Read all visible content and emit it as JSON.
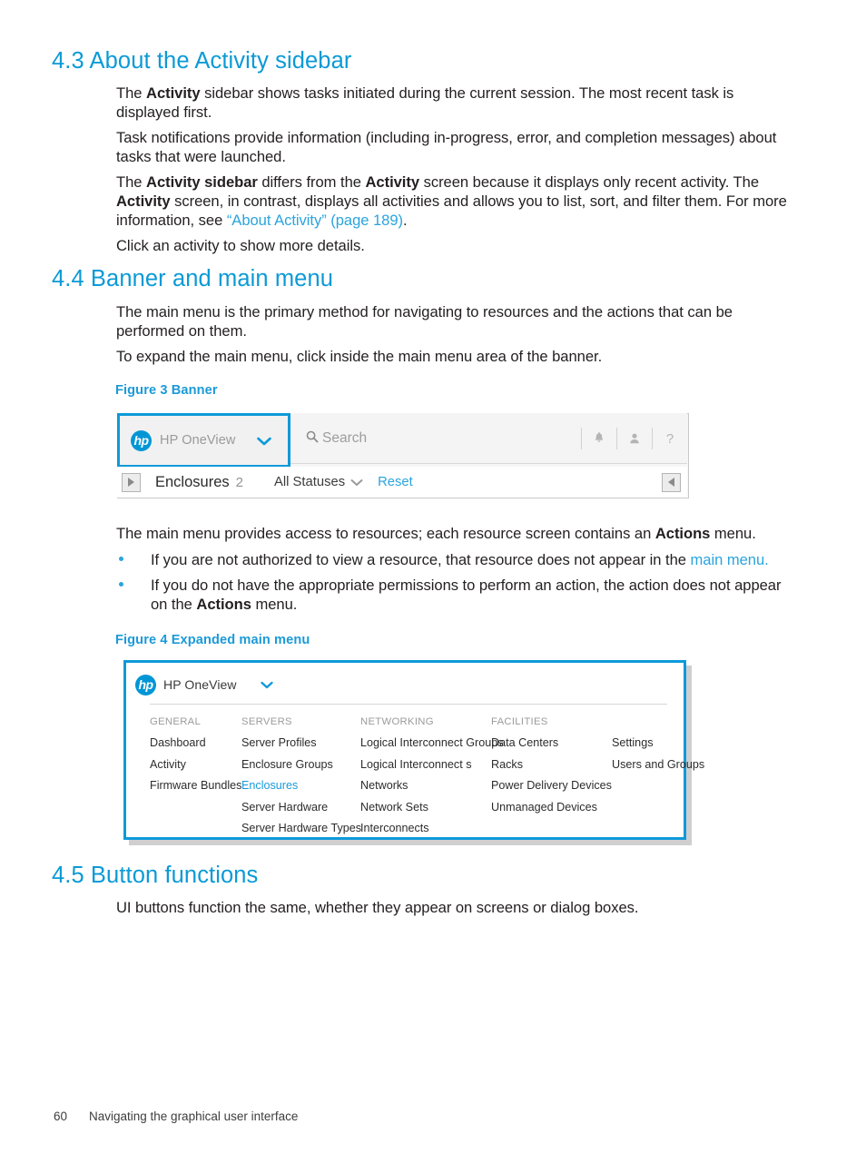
{
  "sections": [
    {
      "id": "activity-sidebar",
      "heading": "4.3 About the Activity sidebar",
      "paragraphs": [
        {
          "id": "p1",
          "runs": [
            {
              "t": "The ",
              "s": "n"
            },
            {
              "t": "Activity",
              "s": "b"
            },
            {
              "t": " sidebar shows tasks initiated during the current session. The most recent task is displayed first.",
              "s": "n"
            }
          ]
        },
        {
          "id": "p2",
          "runs": [
            {
              "t": "Task notifications provide information (including in-progress, error, and completion messages) about tasks that were launched.",
              "s": "n"
            }
          ]
        },
        {
          "id": "p3",
          "runs": [
            {
              "t": "The ",
              "s": "n"
            },
            {
              "t": "Activity sidebar",
              "s": "b"
            },
            {
              "t": " differs from the ",
              "s": "n"
            },
            {
              "t": "Activity",
              "s": "b"
            },
            {
              "t": " screen because it displays only recent activity. The ",
              "s": "n"
            },
            {
              "t": "Activity",
              "s": "b"
            },
            {
              "t": " screen, in contrast, displays all activities and allows you to list, sort, and filter them. For more information, see ",
              "s": "n"
            },
            {
              "t": "“About Activity” (page 189)",
              "s": "link"
            },
            {
              "t": ".",
              "s": "n"
            }
          ]
        },
        {
          "id": "p4",
          "runs": [
            {
              "t": "Click an activity to show more details.",
              "s": "n"
            }
          ]
        }
      ]
    },
    {
      "id": "banner-main-menu",
      "heading": "4.4 Banner and main menu",
      "paragraphs": [
        {
          "id": "p1",
          "runs": [
            {
              "t": "The main menu is the primary method for navigating to resources and the actions that can be performed on them.",
              "s": "n"
            }
          ]
        },
        {
          "id": "p2",
          "runs": [
            {
              "t": "To expand the main menu, click inside the main menu area of the banner.",
              "s": "n"
            }
          ]
        }
      ],
      "after_paragraphs": [
        {
          "id": "p3",
          "runs": [
            {
              "t": "The main menu provides access to resources; each resource screen contains an ",
              "s": "n"
            },
            {
              "t": "Actions",
              "s": "b"
            },
            {
              "t": " menu.",
              "s": "n"
            }
          ]
        }
      ],
      "bullets": [
        {
          "id": "b1",
          "runs": [
            {
              "t": "If you are not authorized to view a resource, that resource does not appear in the ",
              "s": "n"
            },
            {
              "t": "main menu.",
              "s": "link"
            }
          ]
        },
        {
          "id": "b2",
          "runs": [
            {
              "t": "If you do not have the appropriate permissions to perform an action, the action does not appear on the ",
              "s": "n"
            },
            {
              "t": "Actions",
              "s": "b"
            },
            {
              "t": " menu.",
              "s": "n"
            }
          ]
        }
      ]
    },
    {
      "id": "button-functions",
      "heading": "4.5 Button functions",
      "paragraphs": [
        {
          "id": "p1",
          "runs": [
            {
              "t": "UI buttons function the same, whether they appear on screens or dialog boxes.",
              "s": "n"
            }
          ]
        }
      ]
    }
  ],
  "figure3": {
    "caption": "Figure 3 Banner",
    "banner": {
      "main_menu": {
        "logo_text": "hp",
        "product_title": "HP OneView",
        "chevron": "⌄"
      },
      "search": {
        "icon": "search-icon",
        "placeholder": "Search"
      },
      "icons": [
        {
          "name": "notification-bell-icon",
          "glyph": "🔔"
        },
        {
          "name": "user-account-icon",
          "glyph": "👤"
        },
        {
          "name": "help-icon",
          "glyph": "?"
        }
      ],
      "resource_bar": {
        "expand_button": "expand-sidebar-button",
        "resource_name": "Enclosures",
        "resource_count": "2",
        "filter_label": "All Statuses",
        "filter_chevron": "⌄",
        "reset_label": "Reset",
        "collapse_button": "collapse-panel-button"
      }
    }
  },
  "figure4": {
    "caption": "Figure 4 Expanded main menu",
    "menu": {
      "logo_text": "hp",
      "product_title": "HP OneView",
      "chevron": "⌄",
      "columns": [
        {
          "header": "GENERAL",
          "items": [
            {
              "label": "Dashboard",
              "active": false
            },
            {
              "label": "Activity",
              "active": false
            },
            {
              "label": "Firmware Bundles",
              "active": false
            }
          ]
        },
        {
          "header": "SERVERS",
          "items": [
            {
              "label": "Server Profiles",
              "active": false
            },
            {
              "label": "Enclosure Groups",
              "active": false
            },
            {
              "label": "Enclosures",
              "active": true
            },
            {
              "label": "Server Hardware",
              "active": false
            },
            {
              "label": "Server Hardware Types",
              "active": false
            }
          ]
        },
        {
          "header": "NETWORKING",
          "items": [
            {
              "label": "Logical Interconnect Groups",
              "active": false
            },
            {
              "label": "Logical Interconnect s",
              "active": false
            },
            {
              "label": "Networks",
              "active": false
            },
            {
              "label": "Network Sets",
              "active": false
            },
            {
              "label": "Interconnects",
              "active": false
            }
          ]
        },
        {
          "header": "FACILITIES",
          "items": [
            {
              "label": "Data Centers",
              "active": false
            },
            {
              "label": "Racks",
              "active": false
            },
            {
              "label": "Power Delivery Devices",
              "active": false
            },
            {
              "label": "Unmanaged Devices",
              "active": false
            }
          ]
        },
        {
          "header": "",
          "items": [
            {
              "label": "Settings",
              "active": false
            },
            {
              "label": "Users and Groups",
              "active": false
            }
          ]
        }
      ]
    }
  },
  "footer": {
    "page_number": "60",
    "chapter_title": "Navigating the graphical user interface"
  },
  "colors": {
    "heading_blue": "#0b9ad6",
    "link_blue": "#2aa4dd",
    "accent_blue": "#0e9ad9",
    "hp_logo_blue": "#0096d6",
    "body_text": "#231f20"
  }
}
